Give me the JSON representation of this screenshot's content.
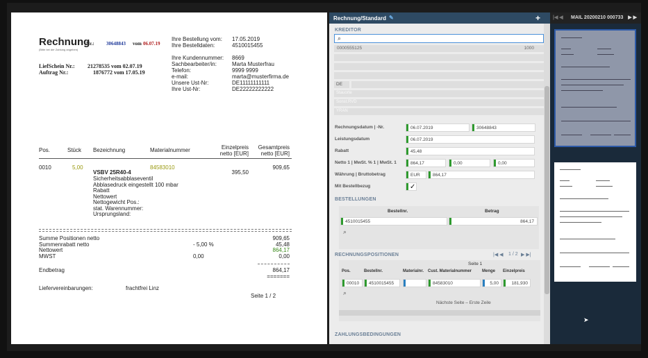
{
  "invoice": {
    "title": "Rechnung",
    "nr_label": "Nr.:",
    "nr_value": "30648843",
    "vom_label": "vom",
    "vom_date": "06.07.19",
    "subnote": "(Bitte bei der Zahlung angeben)",
    "lieferschein_label": "LiefSchein Nr.:",
    "lieferschein_value": "21278535 vom 02.07.19",
    "auftrag_label": "Auftrag Nr.:",
    "auftrag_value": "1876772 vom 17.05.19",
    "right_labels": [
      "Ihre Bestellung vom:",
      "Ihre Bestelldaten:",
      "",
      "Ihre Kundennummer:",
      "Sachbearbeiter/in:",
      "Telefon:",
      "e-mail:",
      "Unsere Ust-Nr:",
      "Ihre Ust-Nr:"
    ],
    "right_values": [
      "17.05.2019",
      "4510015455",
      "",
      "8669",
      "Marta Musterfrau",
      "9999 9999",
      "marta@musterfirma.de",
      "DE11111111111",
      "DE22222222222"
    ],
    "columns": [
      "Pos.",
      "Stück",
      "Bezeichnung",
      "Materialnummer",
      "Einzelpreis netto [EUR]",
      "Gesamtpreis netto [EUR]"
    ],
    "col_einzel": [
      "Einzelpreis",
      "netto [EUR]"
    ],
    "col_gesamt": [
      "Gesamtpreis",
      "netto [EUR]"
    ],
    "row": {
      "pos": "0010",
      "qty": "5,00",
      "name": "VSBV 25R40-4",
      "material": "84583010",
      "unit": "395,50",
      "total": "909,65",
      "details": [
        "Sicherheitsabblaseventil",
        "Abblasedruck eingestellt 100 mbar",
        "Rabatt",
        "Nettowert",
        "Nettogewicht Pos.:",
        "stat. Warennummer:",
        "Ursprungsland:"
      ]
    },
    "summary": {
      "labels": [
        "Summe Positionen netto",
        "Summenrabatt netto",
        "Nettowert",
        "MWST"
      ],
      "pct": [
        "",
        "- 5,00 %",
        "",
        "0,00"
      ],
      "values": [
        "909,65",
        "45,48",
        "864,17",
        "0,00"
      ],
      "end_label": "Endbetrag",
      "end_value": "864,17",
      "end_underline": "=======",
      "liefer_label": "Liefervereinbarungen:",
      "liefer_value": "frachtfrei Linz",
      "page": "Seite 1 /  2"
    }
  },
  "form": {
    "header": "Rechnung/Standard",
    "plus": "+",
    "kreditor_section": "KREDITOR",
    "search_value": "",
    "kreditor_id": "0000555125",
    "kreditor_num": "1000",
    "country": "DE",
    "ghost_rows": [
      "Stauorte",
      "Sonst.RVD",
      "YRAN"
    ],
    "rows": [
      {
        "label": "Rechnungsdatum | -Nr.",
        "v1": "06.07.2019",
        "v2": "30648843"
      },
      {
        "label": "Leistungsdatum",
        "v1": "06.07.2019"
      },
      {
        "label": "Rabatt",
        "v1": "45,48"
      },
      {
        "label": "Netto 1 | MwSt. % 1 | MwSt. 1",
        "v1": "864,17",
        "v2": "0,00",
        "v3": "0,00"
      },
      {
        "label": "Währung | Bruttobetrag",
        "v1": "EUR",
        "v2": "864,17"
      },
      {
        "label": "Mit Bestellbezug",
        "v1": "✓"
      }
    ],
    "bestellungen_section": "BESTELLUNGEN",
    "best_cols": [
      "Bestellnr.",
      "Betrag"
    ],
    "best_row": [
      "4510015455",
      "864,17"
    ],
    "rp_section": "RECHNUNGSPOSITIONEN",
    "rp_pager": "1 / 2",
    "rp_seite": "Seite 1",
    "rp_cols": [
      "Pos.",
      "Bestellnr.",
      "Materialnr.",
      "Cust. Materialnummer",
      "Menge",
      "Einzelpreis"
    ],
    "rp_row": [
      "00010",
      "4510015455",
      "",
      "84583010",
      "5,00",
      "181,930"
    ],
    "rp_next": "Nächste Seite – Erste Zeile",
    "zahlung_section": "ZAHLUNGSBEDINGUNGEN"
  },
  "viewer": {
    "title": "MAIL 20200210 000733"
  }
}
